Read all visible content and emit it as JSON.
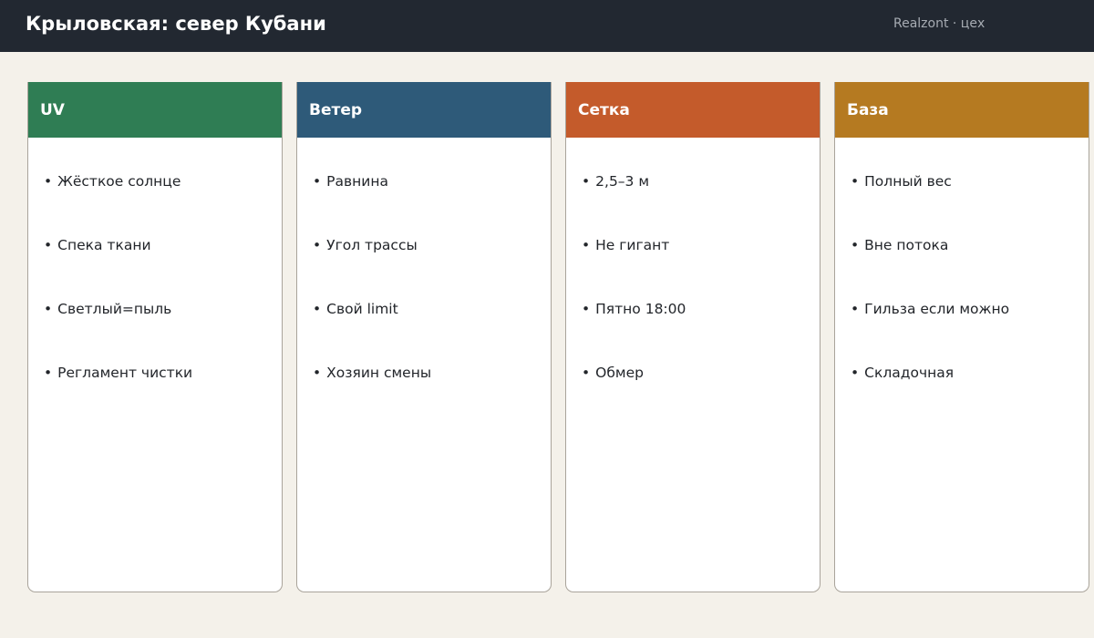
{
  "header": {
    "title": "Крыловская: север Кубани",
    "brand": "Realzont · цех"
  },
  "colors": {
    "topbar": "#222831",
    "background": "#f4f1ea",
    "uv": "#2f7d54",
    "wind": "#2e5a79",
    "grid": "#c45b2b",
    "base": "#b57a21"
  },
  "cards": [
    {
      "title": "UV",
      "items": [
        "Жёсткое солнце",
        "Спека ткани",
        "Светлый=пыль",
        "Регламент чистки"
      ]
    },
    {
      "title": "Ветер",
      "items": [
        "Равнина",
        "Угол трассы",
        "Свой limit",
        "Хозяин смены"
      ]
    },
    {
      "title": "Сетка",
      "items": [
        "2,5–3 м",
        "Не гигант",
        "Пятно 18:00",
        "Обмер"
      ]
    },
    {
      "title": "База",
      "items": [
        "Полный вес",
        "Вне потока",
        "Гильза если можно",
        "Складочная"
      ]
    }
  ]
}
